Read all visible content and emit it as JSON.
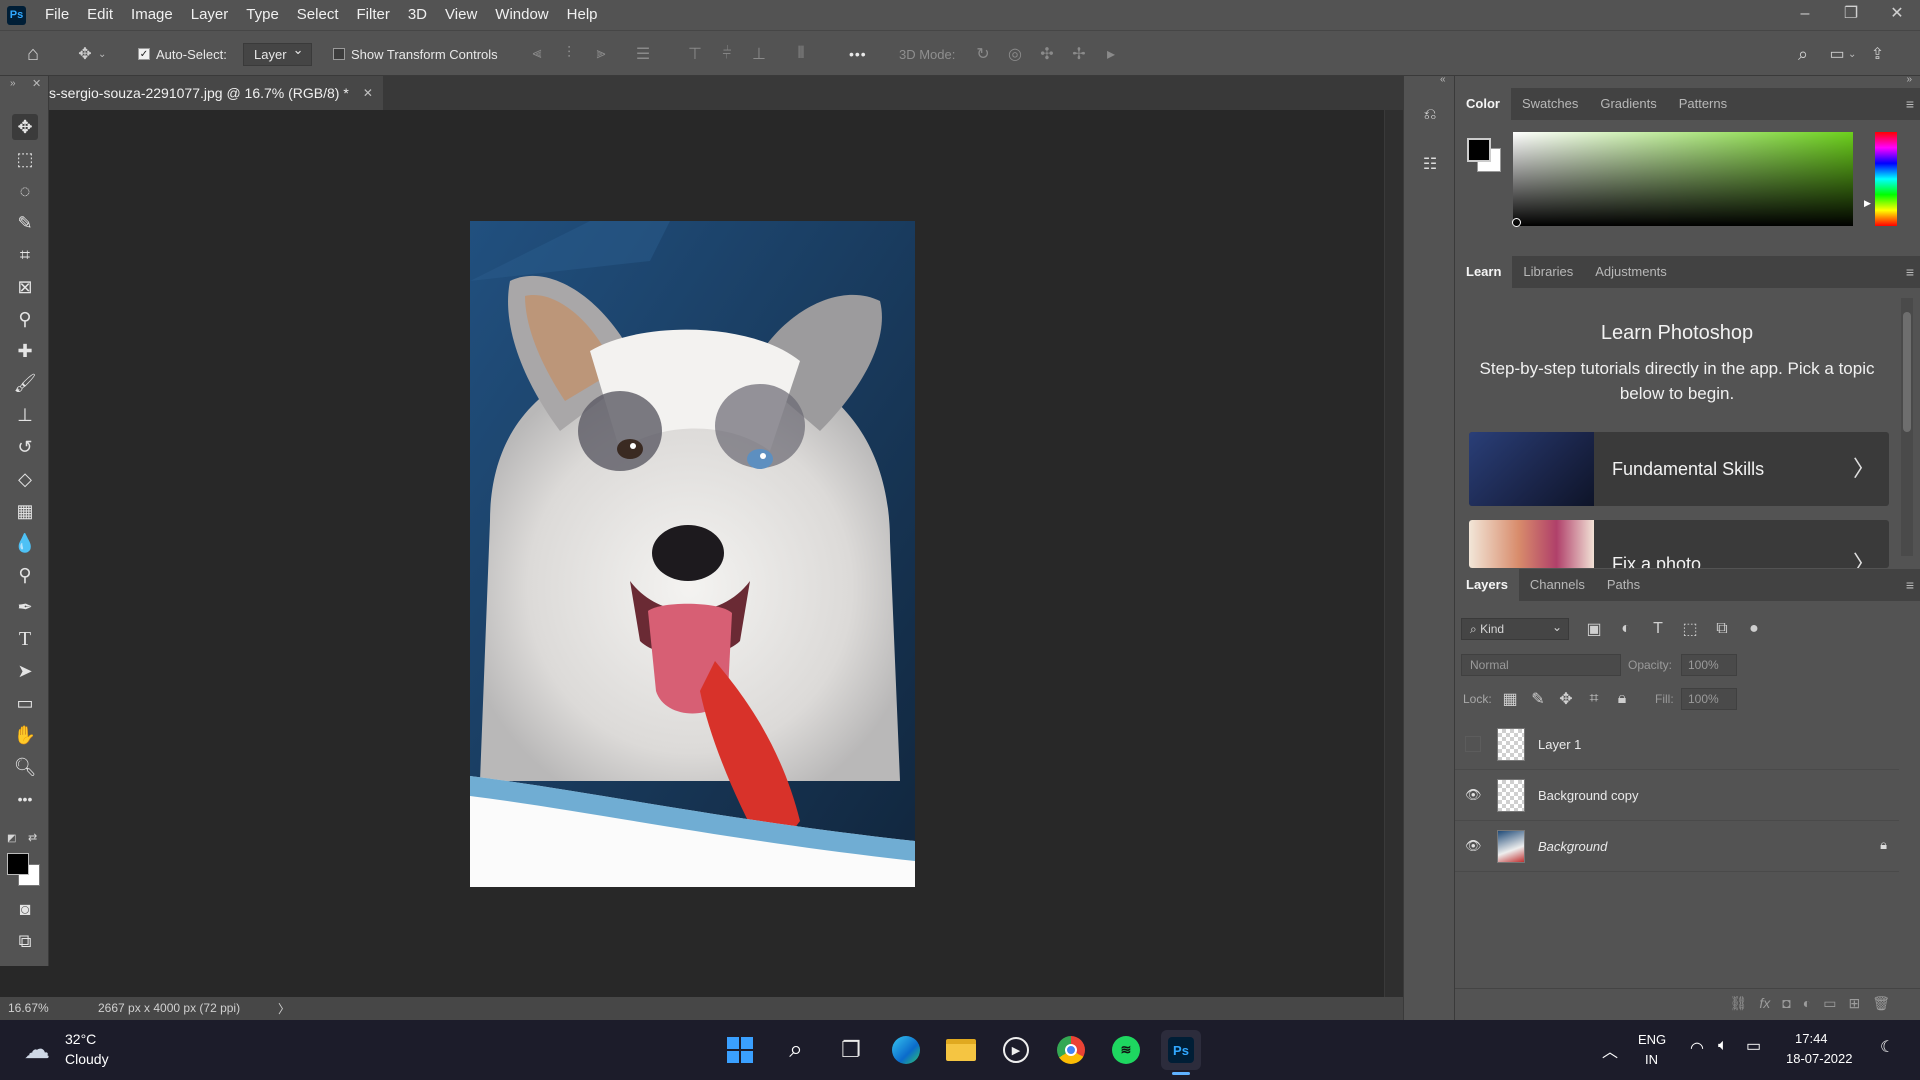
{
  "app": {
    "logo": "Ps",
    "menu": [
      "File",
      "Edit",
      "Image",
      "Layer",
      "Type",
      "Select",
      "Filter",
      "3D",
      "View",
      "Window",
      "Help"
    ],
    "window_controls": [
      "–",
      "❐",
      "✕"
    ]
  },
  "options_bar": {
    "auto_select_label": "Auto-Select:",
    "auto_select_checked": true,
    "auto_select_target": "Layer",
    "show_transform_controls_label": "Show Transform Controls",
    "more_label": "•••",
    "mode_3d_label": "3D Mode:"
  },
  "document": {
    "tab_title": "s-sergio-souza-2291077.jpg @ 16.7% (RGB/8) *",
    "zoom": "16.67%",
    "dimensions": "2667 px x 4000 px (72 ppi)"
  },
  "color_panel": {
    "tabs": [
      "Color",
      "Swatches",
      "Gradients",
      "Patterns"
    ],
    "active_tab": "Color",
    "foreground": "#000000",
    "background": "#ffffff",
    "hue_color": "#6cd01c"
  },
  "learn_panel": {
    "tabs": [
      "Learn",
      "Libraries",
      "Adjustments"
    ],
    "active_tab": "Learn",
    "title": "Learn Photoshop",
    "subtitle": "Step-by-step tutorials directly in the app. Pick a topic below to begin.",
    "cards": [
      {
        "label": "Fundamental Skills"
      },
      {
        "label": "Fix a photo"
      }
    ]
  },
  "layers_panel": {
    "tabs": [
      "Layers",
      "Channels",
      "Paths"
    ],
    "active_tab": "Layers",
    "filter_kind": "Kind",
    "blend_mode": "Normal",
    "opacity_label": "Opacity:",
    "opacity_value": "100%",
    "lock_label": "Lock:",
    "fill_label": "Fill:",
    "fill_value": "100%",
    "layers": [
      {
        "name": "Layer 1",
        "visible": false,
        "locked": false,
        "italic": false
      },
      {
        "name": "Background copy",
        "visible": true,
        "locked": false,
        "italic": false
      },
      {
        "name": "Background",
        "visible": true,
        "locked": true,
        "italic": true
      }
    ]
  },
  "taskbar": {
    "weather_temp": "32°C",
    "weather_desc": "Cloudy",
    "lang_top": "ENG",
    "lang_bottom": "IN",
    "time": "17:44",
    "date": "18-07-2022"
  }
}
